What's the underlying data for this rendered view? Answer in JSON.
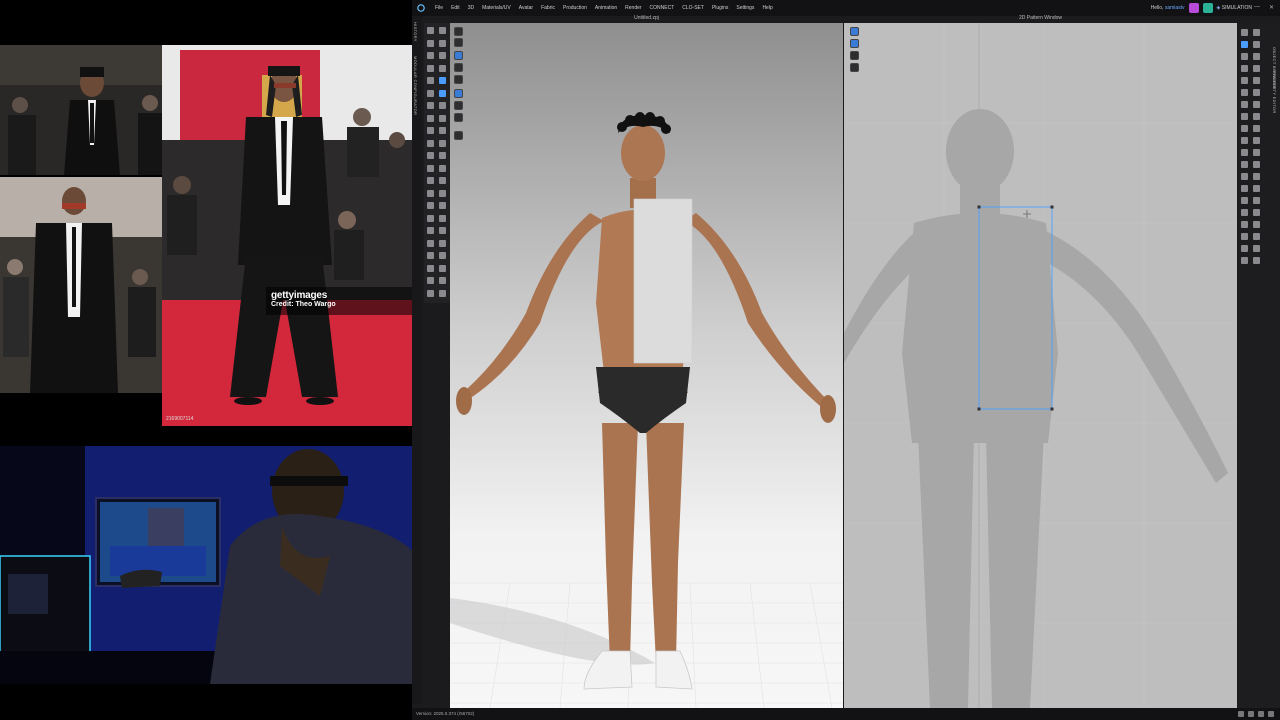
{
  "collage": {
    "watermark_logo": "gettyimages",
    "watermark_credit": "Credit: Theo Wargo",
    "image_id": "2169007114"
  },
  "app": {
    "menu": [
      "File",
      "Edit",
      "3D",
      "Materials/UV",
      "Avatar",
      "Fabric",
      "Production",
      "Animation",
      "Render",
      "CONNECT",
      "CLO-SET",
      "Plugins",
      "Settings",
      "Help"
    ],
    "greeting_prefix": "Hello,",
    "username": "samiastv",
    "mode": "SIMULATION",
    "left_vertical_tabs": [
      "HISTORY",
      "MODULAR CONFIGURATOR"
    ],
    "viewport_3d_title": "Untitled.zpj",
    "pattern_window_title": "2D Pattern Window",
    "right_vertical_tabs": [
      "OBJECT BROWSER",
      "PROPERTY EDITOR"
    ],
    "version": "Version: 2025.0.374 (r56702)",
    "colors": {
      "accent": "#4a9cff",
      "menubar_bg": "#121214",
      "panel_bg": "#1b1b1d",
      "pattern_bg": "#bebebe",
      "pattern_line": "#4aa0ff"
    },
    "icons": {
      "app_logo": "clo-logo-icon",
      "badge_1": "chat-icon",
      "badge_2": "user-icon"
    }
  }
}
